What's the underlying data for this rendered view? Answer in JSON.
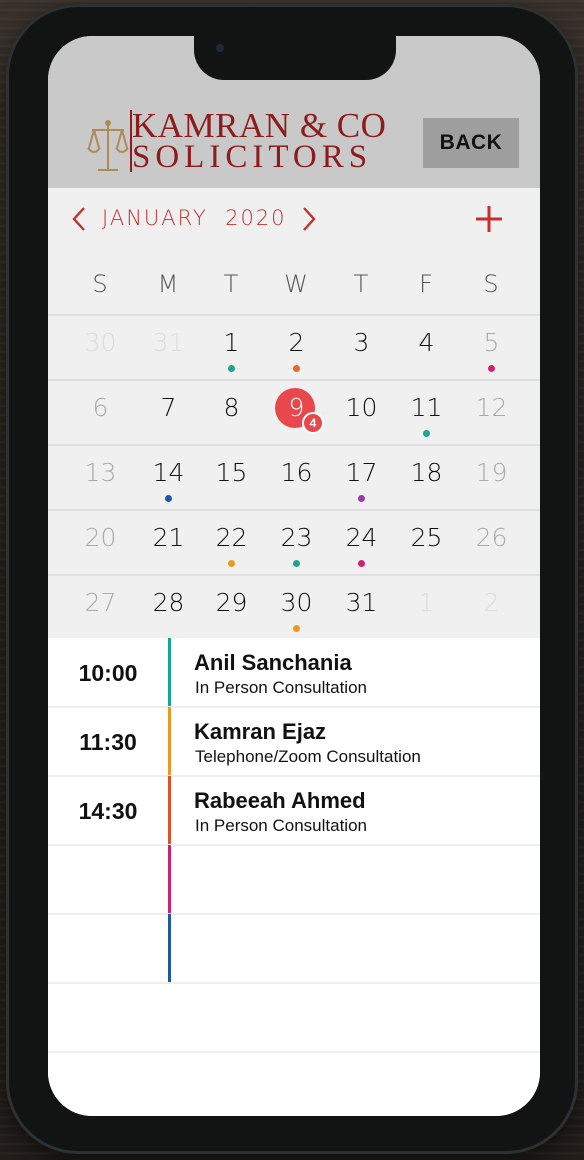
{
  "header": {
    "brand_line1": "KAMRAN & CO",
    "brand_line2": "SOLICITORS",
    "back_label": "BACK"
  },
  "calendar": {
    "month": "JANUARY",
    "year": "2020",
    "weekdays": [
      "S",
      "M",
      "T",
      "W",
      "T",
      "F",
      "S"
    ],
    "today": "9",
    "today_badge": "4",
    "weeks": [
      [
        {
          "d": "30",
          "state": "faint"
        },
        {
          "d": "31",
          "state": "faint"
        },
        {
          "d": "1",
          "dot": "#1aa595"
        },
        {
          "d": "2",
          "dot": "#e5692a"
        },
        {
          "d": "3"
        },
        {
          "d": "4"
        },
        {
          "d": "5",
          "state": "muted",
          "dot": "#d11f72"
        }
      ],
      [
        {
          "d": "6",
          "state": "muted"
        },
        {
          "d": "7"
        },
        {
          "d": "8"
        },
        {
          "d": "9",
          "state": "today"
        },
        {
          "d": "10"
        },
        {
          "d": "11",
          "dot": "#1aa595"
        },
        {
          "d": "12",
          "state": "muted"
        }
      ],
      [
        {
          "d": "13",
          "state": "muted"
        },
        {
          "d": "14",
          "dot": "#1f57a8"
        },
        {
          "d": "15"
        },
        {
          "d": "16"
        },
        {
          "d": "17",
          "dot": "#9a3aa8"
        },
        {
          "d": "18"
        },
        {
          "d": "19",
          "state": "muted"
        }
      ],
      [
        {
          "d": "20",
          "state": "muted"
        },
        {
          "d": "21"
        },
        {
          "d": "22",
          "dot": "#e89a22"
        },
        {
          "d": "23",
          "dot": "#1aa595"
        },
        {
          "d": "24",
          "dot": "#d11f72"
        },
        {
          "d": "25"
        },
        {
          "d": "26",
          "state": "muted"
        }
      ],
      [
        {
          "d": "27",
          "state": "muted"
        },
        {
          "d": "28"
        },
        {
          "d": "29"
        },
        {
          "d": "30",
          "dot": "#e89a22"
        },
        {
          "d": "31"
        },
        {
          "d": "1",
          "state": "faint"
        },
        {
          "d": "2",
          "state": "faint"
        }
      ]
    ]
  },
  "schedule": [
    {
      "time": "10:00",
      "name": "Anil Sanchania",
      "type": "In Person Consultation",
      "color": "#1aa595"
    },
    {
      "time": "11:30",
      "name": "Kamran Ejaz",
      "type": "Telephone/Zoom Consultation",
      "color": "#e89a22"
    },
    {
      "time": "14:30",
      "name": "Rabeeah Ahmed",
      "type": "In Person Consultation",
      "color": "#d9532b"
    },
    {
      "time": "",
      "name": "",
      "type": "",
      "color": "#d11f72"
    },
    {
      "time": "",
      "name": "",
      "type": "",
      "color": "#1f57a8"
    },
    {
      "time": "",
      "name": "",
      "type": "",
      "color": ""
    }
  ],
  "colors": {
    "accent": "#c4302b",
    "today": "#e8474b",
    "brand": "#8d1c1c"
  }
}
